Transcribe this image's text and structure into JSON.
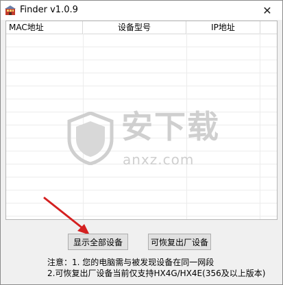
{
  "window": {
    "title": "Finder v1.0.9",
    "close_glyph": "✕"
  },
  "table": {
    "columns": [
      "MAC地址",
      "设备型号",
      "IP地址"
    ],
    "rows": []
  },
  "buttons": {
    "show_all": "显示全部设备",
    "restorable": "可恢复出厂设备"
  },
  "notes": {
    "line1": "注意：1. 您的电脑需与被发现设备在同一网段",
    "line2": "2.可恢复出厂设备当前仅支持HX4G/HX4E(356及以上版本)"
  },
  "watermark": {
    "text": "安下载",
    "sub": "anxz.com"
  },
  "colors": {
    "arrow": "#d42020",
    "watermark": "#cfcfcf"
  }
}
